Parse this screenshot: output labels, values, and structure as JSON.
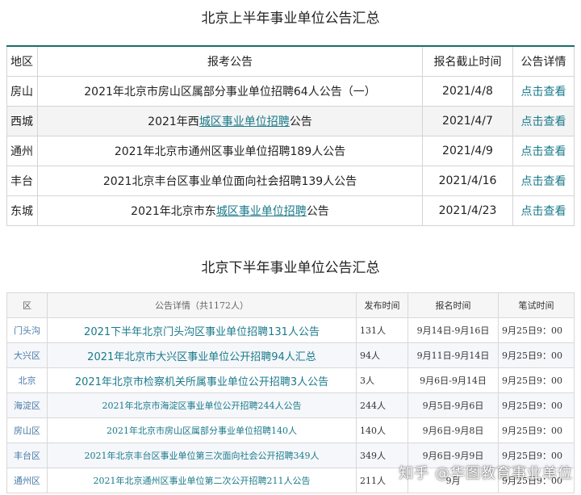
{
  "section1": {
    "title": "北京上半年事业单位公告汇总",
    "headers": [
      "地区",
      "报考公告",
      "报名截止时间",
      "公告详情"
    ],
    "rows": [
      {
        "area": "房山",
        "pre": "2021年北京市房山区属部分事业单位招聘64人公告（一）",
        "link": "",
        "post": "",
        "date": "2021/4/8",
        "detail": "点击查看"
      },
      {
        "area": "西城",
        "pre": "2021年西",
        "link": "城区事业单位招聘",
        "post": "公告",
        "date": "2021/4/7",
        "detail": "点击查看"
      },
      {
        "area": "通州",
        "pre": "2021年北京市通州区事业单位招聘189人公告",
        "link": "",
        "post": "",
        "date": "2021/4/9",
        "detail": "点击查看"
      },
      {
        "area": "丰台",
        "pre": "2021北京丰台区事业单位面向社会招聘139人公告",
        "link": "",
        "post": "",
        "date": "2021/4/16",
        "detail": "点击查看"
      },
      {
        "area": "东城",
        "pre": "2021年北京市东",
        "link": "城区事业单位招聘",
        "post": "公告",
        "date": "2021/4/23",
        "detail": "点击查看"
      }
    ]
  },
  "section2": {
    "title": "北京下半年事业单位公告汇总",
    "headers": [
      "区",
      "公告详情（共1172人）",
      "发布时间",
      "报名时间",
      "笔试时间"
    ],
    "rows": [
      {
        "area": "门头沟",
        "notice": "2021下半年北京门头沟区事业单位招聘131人公告",
        "pub": "131人",
        "reg": "9月14日-9月16日",
        "exam": "9月25日9：00"
      },
      {
        "area": "大兴区",
        "notice": "2021年北京市大兴区事业单位公开招聘94人汇总",
        "pub": "94人",
        "reg": "9月11日-9月14日",
        "exam": "9月25日9：00"
      },
      {
        "area": "北京",
        "notice": "2021年北京市检察机关所属事业单位公开招聘3人公告",
        "pub": "3人",
        "reg": "9月6日-9月14日",
        "exam": "9月25日9：00"
      },
      {
        "area": "海淀区",
        "notice": "2021年北京市海淀区事业单位公开招聘244人公告",
        "pub": "244人",
        "reg": "9月5日-9月6日",
        "exam": "9月25日9：00"
      },
      {
        "area": "房山区",
        "notice": "2021年北京市房山区属部分事业单位招聘140人",
        "pub": "140人",
        "reg": "9月6日-9月8日",
        "exam": "9月25日9：00"
      },
      {
        "area": "丰台区",
        "notice": "2021年北京丰台区事业单位第三次面向社会公开招聘349人",
        "pub": "349人",
        "reg": "9月6日-9月9日",
        "exam": "9月25日9：00"
      },
      {
        "area": "通州区",
        "notice": "2021年北京通州区事业单位第二次公开招聘211人公告",
        "pub": "211人",
        "reg": "9月",
        "exam": "9月25日9：00"
      }
    ]
  },
  "watermark": "知乎 @华图教育事业单位"
}
